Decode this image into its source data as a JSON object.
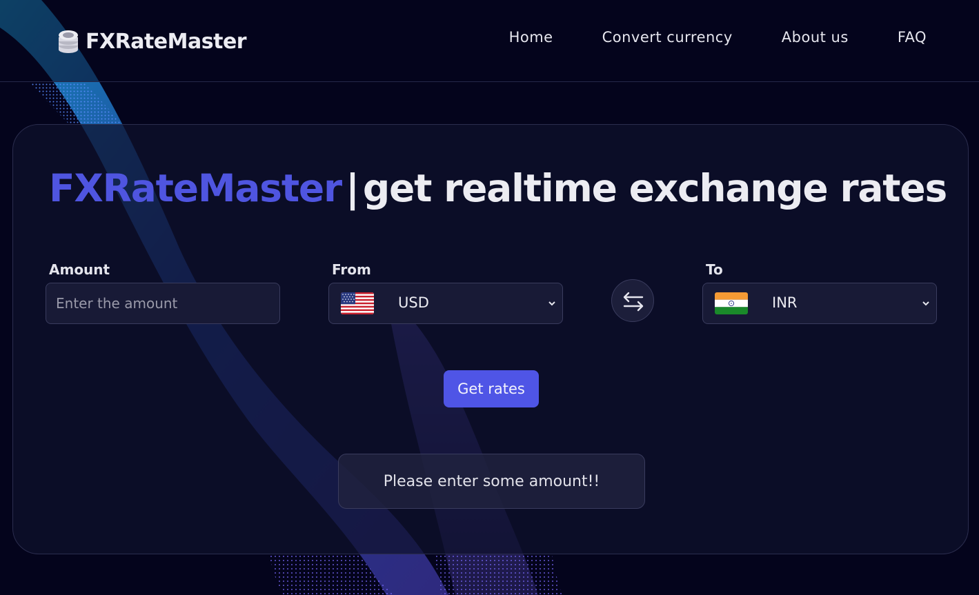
{
  "brand": {
    "name": "FXRateMaster",
    "logo_icon": "coins-stack-icon"
  },
  "nav": {
    "items": [
      {
        "label": "Home"
      },
      {
        "label": "Convert currency"
      },
      {
        "label": "About us"
      },
      {
        "label": "FAQ"
      }
    ]
  },
  "hero": {
    "brand": "FXRateMaster",
    "separator": "|",
    "tagline": "get realtime exchange rates"
  },
  "form": {
    "amount": {
      "label": "Amount",
      "value": "",
      "placeholder": "Enter the amount"
    },
    "from": {
      "label": "From",
      "value": "USD",
      "flag_icon": "us-flag-icon"
    },
    "to": {
      "label": "To",
      "value": "INR",
      "flag_icon": "india-flag-icon"
    },
    "swap_icon": "swap-arrows-icon",
    "submit_label": "Get rates"
  },
  "result": {
    "message": "Please enter some amount!!"
  },
  "colors": {
    "accent": "#4f55e6",
    "background": "#04041c",
    "card": "#0e102c"
  }
}
